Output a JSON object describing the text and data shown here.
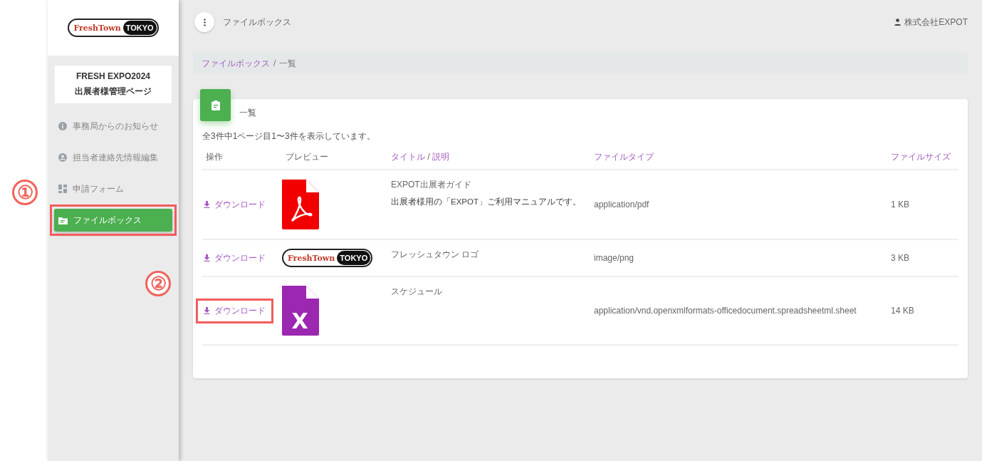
{
  "sidebar": {
    "logo": {
      "wordmark": "FreshTown",
      "badge": "TOKYO"
    },
    "site_card": {
      "line1": "FRESH EXPO2024",
      "line2": "出展者様管理ページ"
    },
    "items": [
      {
        "label": "事務局からのお知らせ",
        "kind": "info",
        "selected": false,
        "highlighted": false
      },
      {
        "label": "担当者連絡先情報編集",
        "kind": "account",
        "selected": false,
        "highlighted": false
      },
      {
        "label": "申請フォーム",
        "kind": "dashboard",
        "selected": false,
        "highlighted": false
      },
      {
        "label": "ファイルボックス",
        "kind": "folder",
        "selected": true,
        "highlighted": true
      }
    ]
  },
  "header": {
    "title": "ファイルボックス",
    "user": "株式会社EXPOT"
  },
  "breadcrumb": {
    "link": "ファイルボックス",
    "separator": "/",
    "current": "一覧"
  },
  "card": {
    "title": "一覧",
    "summary": "全3件中1ページ目1〜3件を表示しています。",
    "columns": [
      {
        "kind": "plain",
        "label": "操作"
      },
      {
        "kind": "plain",
        "label": "プレビュー"
      },
      {
        "kind": "split",
        "labels": [
          "タイトル",
          "説明"
        ],
        "separator": "/"
      },
      {
        "kind": "accent",
        "label": "ファイルタイプ"
      },
      {
        "kind": "accent",
        "label": "ファイルサイズ"
      }
    ],
    "rows": [
      {
        "action": "ダウンロード",
        "highlighted": false,
        "preview": {
          "kind": "pdf"
        },
        "title": "EXPOT出展者ガイド",
        "description": "出展者様用の「EXPOT」ご利用マニュアルです。",
        "type": "application/pdf",
        "size": "1 KB"
      },
      {
        "action": "ダウンロード",
        "highlighted": false,
        "preview": {
          "kind": "logo",
          "wordmark": "FreshTown",
          "badge": "TOKYO"
        },
        "title": "フレッシュタウン ロゴ",
        "type": "image/png",
        "size": "3 KB"
      },
      {
        "action": "ダウンロード",
        "highlighted": true,
        "preview": {
          "kind": "excel",
          "letter": "X"
        },
        "title": "スケジュール",
        "type": "application/vnd.openxmlformats-officedocument.spreadsheetml.sheet",
        "size": "14 KB"
      }
    ]
  },
  "callouts": [
    {
      "label": "①"
    },
    {
      "label": "②"
    }
  ]
}
